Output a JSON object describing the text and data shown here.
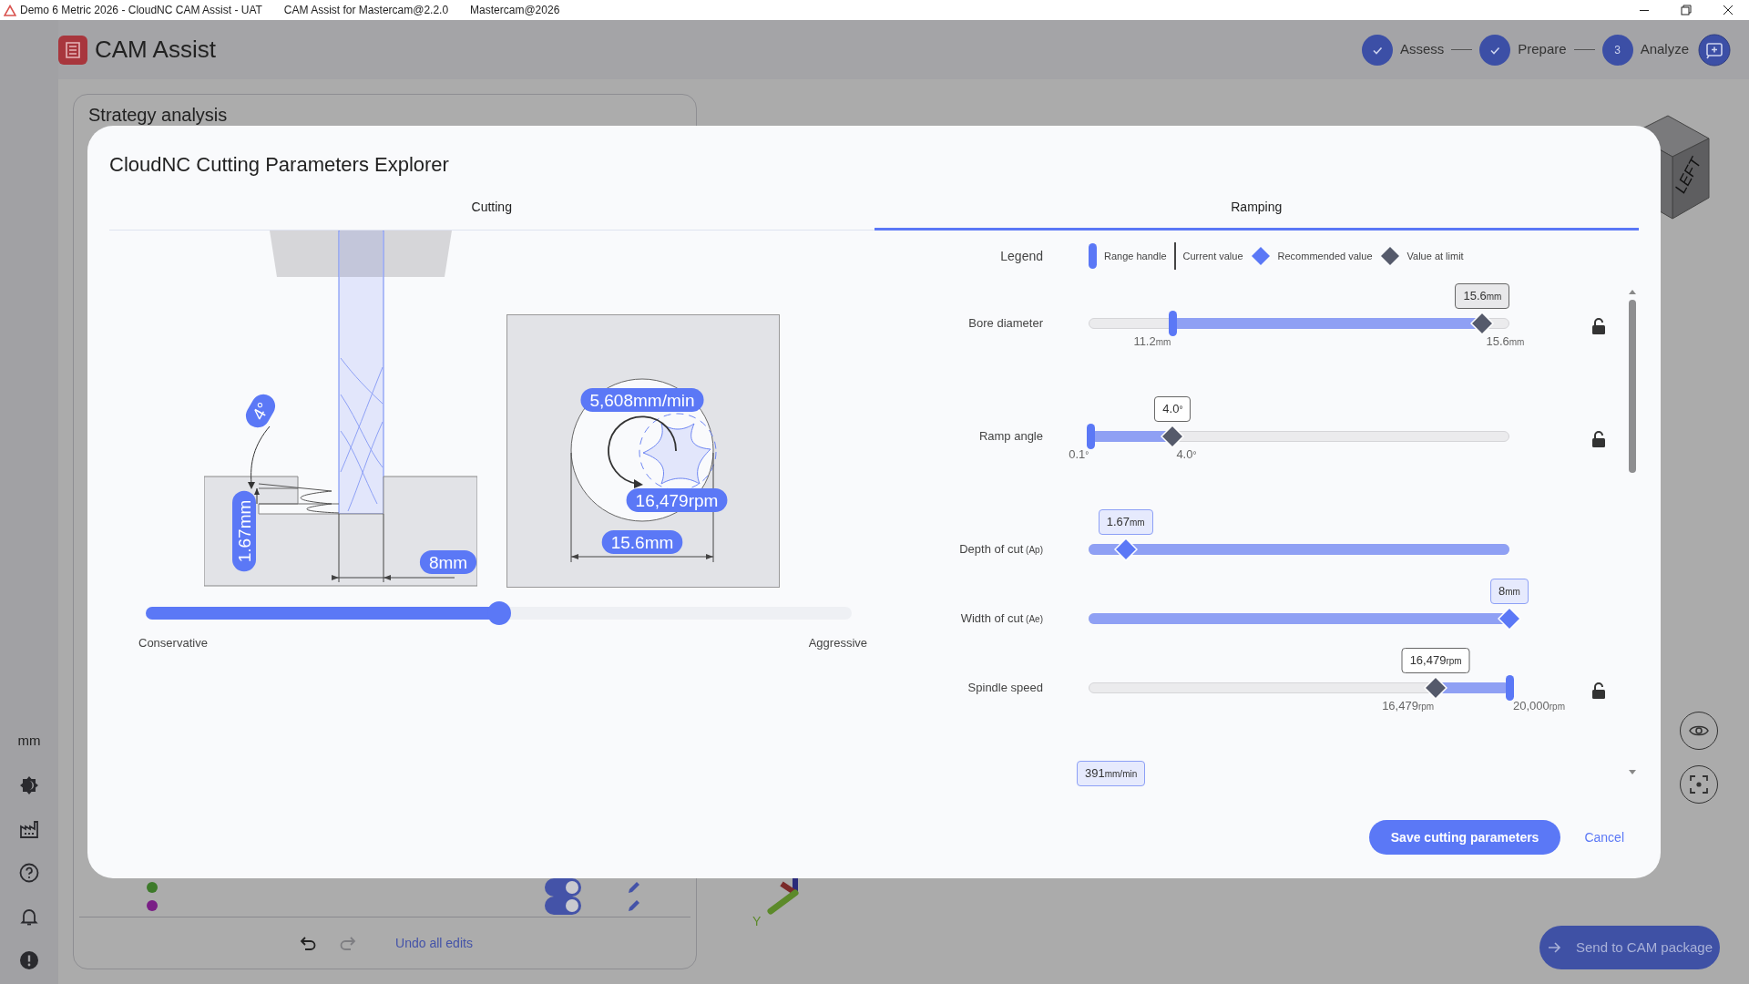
{
  "title_bar": {
    "title": "Demo 6 Metric 2026 - CloudNC CAM Assist - UAT",
    "items": [
      "CAM Assist for Mastercam@2.2.0",
      "Mastercam@2026"
    ]
  },
  "app_header": {
    "title": "CAM Assist",
    "steps": [
      {
        "label": "Assess",
        "completed": true
      },
      {
        "label": "Prepare",
        "completed": true
      },
      {
        "label": "Analyze",
        "number": "3",
        "completed": false
      }
    ]
  },
  "sidebar": {
    "unit": "mm"
  },
  "strategy_panel": {
    "title": "Strategy analysis",
    "rows": [
      {
        "color": "#3d7a2a",
        "on": true
      },
      {
        "color": "#7a1f86",
        "on": true
      }
    ],
    "undo_disabled": false,
    "redo_disabled": true,
    "undo_all": "Undo all edits"
  },
  "viewport": {
    "cube_face": "LEFT",
    "axis_label": "Y",
    "send_button": "Send to CAM package"
  },
  "modal": {
    "title": "CloudNC Cutting Parameters Explorer",
    "tabs": [
      {
        "label": "Cutting",
        "selected": false
      },
      {
        "label": "Ramping",
        "selected": true
      }
    ],
    "cutting": {
      "angle": "4°",
      "depth": "1.67mm",
      "width": "8mm",
      "feed": "5,608mm/min",
      "speed": "16,479rpm",
      "diameter": "15.6mm",
      "slider": {
        "level": 0.5
      },
      "min_label": "Conservative",
      "max_label": "Aggressive"
    },
    "ramping": {
      "legend_title": "Legend",
      "legend": [
        {
          "kind": "handle",
          "label": "Range handle"
        },
        {
          "kind": "current",
          "label": "Current value"
        },
        {
          "kind": "recommended",
          "label": "Recommended value"
        },
        {
          "kind": "limit",
          "label": "Value at limit"
        }
      ],
      "parameters": [
        {
          "kind": "slider",
          "label": "Bore diameter",
          "value": {
            "number": "15.6",
            "unit": "mm"
          },
          "focused": true,
          "marker": {
            "kind": "limit",
            "level": 0.936
          },
          "handles": [
            {
              "level": 0.2
            }
          ],
          "ticks": [
            {
              "number": "11.2",
              "unit": "mm"
            },
            {
              "number": "15.6",
              "unit": "mm"
            }
          ],
          "locked": false
        },
        {
          "kind": "slider",
          "label": "Ramp angle",
          "value": {
            "number": "4.0",
            "unit": "°"
          },
          "focused": false,
          "marker": {
            "kind": "limit",
            "level": 0.2
          },
          "handles": [
            {
              "level": 0.005
            }
          ],
          "ticks": [
            {
              "number": "0.1",
              "unit": "°"
            },
            {
              "number": "4.0",
              "unit": "°"
            }
          ],
          "locked": false
        },
        {
          "kind": "slider",
          "label": "Depth of cut",
          "qualifier": "(Ap)",
          "value": {
            "number": "1.67",
            "unit": "mm"
          },
          "focused": false,
          "marker": {
            "kind": "recommended",
            "level": 0.088
          }
        },
        {
          "kind": "slider",
          "label": "Width of cut",
          "qualifier": "(Ae)",
          "value": {
            "number": "8",
            "unit": "mm"
          },
          "focused": false,
          "marker": {
            "kind": "recommended",
            "level": 1
          }
        },
        {
          "kind": "slider",
          "label": "Spindle speed",
          "value": {
            "number": "16,479",
            "unit": "rpm"
          },
          "focused": false,
          "marker": {
            "kind": "limit",
            "level": 0.825
          },
          "handles": [
            {
              "level": 1
            }
          ],
          "ticks": [
            {
              "number": "16,479",
              "unit": "rpm"
            },
            {
              "number": "20,000",
              "unit": "rpm"
            }
          ],
          "locked": false
        },
        {
          "kind": "value_only",
          "value": {
            "number": "391",
            "unit": "mm/min"
          },
          "focused": false,
          "marker": {
            "kind": "recommended"
          }
        }
      ]
    },
    "save_button": "Save cutting parameters",
    "cancel_button": "Cancel"
  }
}
